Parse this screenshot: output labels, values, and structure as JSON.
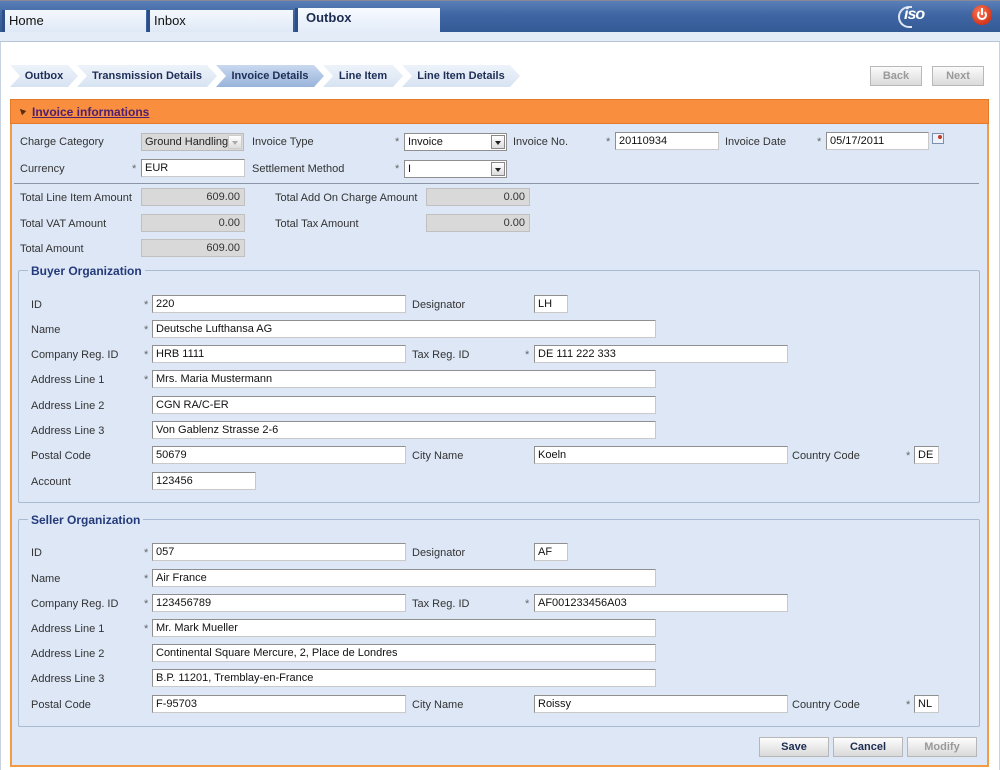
{
  "main_tabs": [
    {
      "label": "Home"
    },
    {
      "label": "Inbox"
    },
    {
      "label": "Outbox",
      "active": true
    }
  ],
  "header": {
    "logo": "iso",
    "power_icon": "power-icon"
  },
  "breadcrumb": [
    {
      "label": "Outbox"
    },
    {
      "label": "Transmission Details"
    },
    {
      "label": "Invoice Details",
      "active": true
    },
    {
      "label": "Line Item"
    },
    {
      "label": "Line Item Details"
    }
  ],
  "nav": {
    "back_label": "Back",
    "next_label": "Next"
  },
  "panel": {
    "title": "Invoice informations"
  },
  "invoice": {
    "charge_category": {
      "label": "Charge Category",
      "value": "Ground Handling"
    },
    "invoice_type": {
      "label": "Invoice Type",
      "value": "Invoice"
    },
    "invoice_no": {
      "label": "Invoice No.",
      "value": "20110934"
    },
    "invoice_date": {
      "label": "Invoice Date",
      "value": "05/17/2011"
    },
    "currency": {
      "label": "Currency",
      "value": "EUR"
    },
    "settlement_method": {
      "label": "Settlement Method",
      "value": "I"
    },
    "required_mark": "*"
  },
  "totals": {
    "line_item": {
      "label": "Total Line Item Amount",
      "value": "609.00"
    },
    "add_on": {
      "label": "Total Add On Charge Amount",
      "value": "0.00"
    },
    "vat": {
      "label": "Total VAT Amount",
      "value": "0.00"
    },
    "tax": {
      "label": "Total Tax Amount",
      "value": "0.00"
    },
    "total": {
      "label": "Total Amount",
      "value": "609.00"
    }
  },
  "labels": {
    "id": "ID",
    "designator": "Designator",
    "name": "Name",
    "company_reg_id": "Company Reg. ID",
    "tax_reg_id": "Tax Reg. ID",
    "address1": "Address Line 1",
    "address2": "Address Line 2",
    "address3": "Address Line 3",
    "postal_code": "Postal Code",
    "city_name": "City Name",
    "country_code": "Country Code",
    "account": "Account"
  },
  "buyer": {
    "title": "Buyer Organization",
    "id": "220",
    "designator": "LH",
    "name": "Deutsche Lufthansa AG",
    "company_reg_id": "HRB 1111",
    "tax_reg_id": "DE 111 222 333",
    "address1": "Mrs. Maria Mustermann",
    "address2": "CGN RA/C-ER",
    "address3": "Von Gablenz Strasse 2-6",
    "postal_code": "50679",
    "city_name": "Koeln",
    "country_code": "DE",
    "account": "123456"
  },
  "seller": {
    "title": "Seller Organization",
    "id": "057",
    "designator": "AF",
    "name": "Air France",
    "company_reg_id": "123456789",
    "tax_reg_id": "AF001233456A03",
    "address1": "Mr. Mark Mueller",
    "address2": "Continental Square Mercure, 2, Place de Londres",
    "address3": "B.P. 11201, Tremblay-en-France",
    "postal_code": "F-95703",
    "city_name": "Roissy",
    "country_code": "NL"
  },
  "actions": {
    "save_label": "Save",
    "cancel_label": "Cancel",
    "modify_label": "Modify"
  }
}
